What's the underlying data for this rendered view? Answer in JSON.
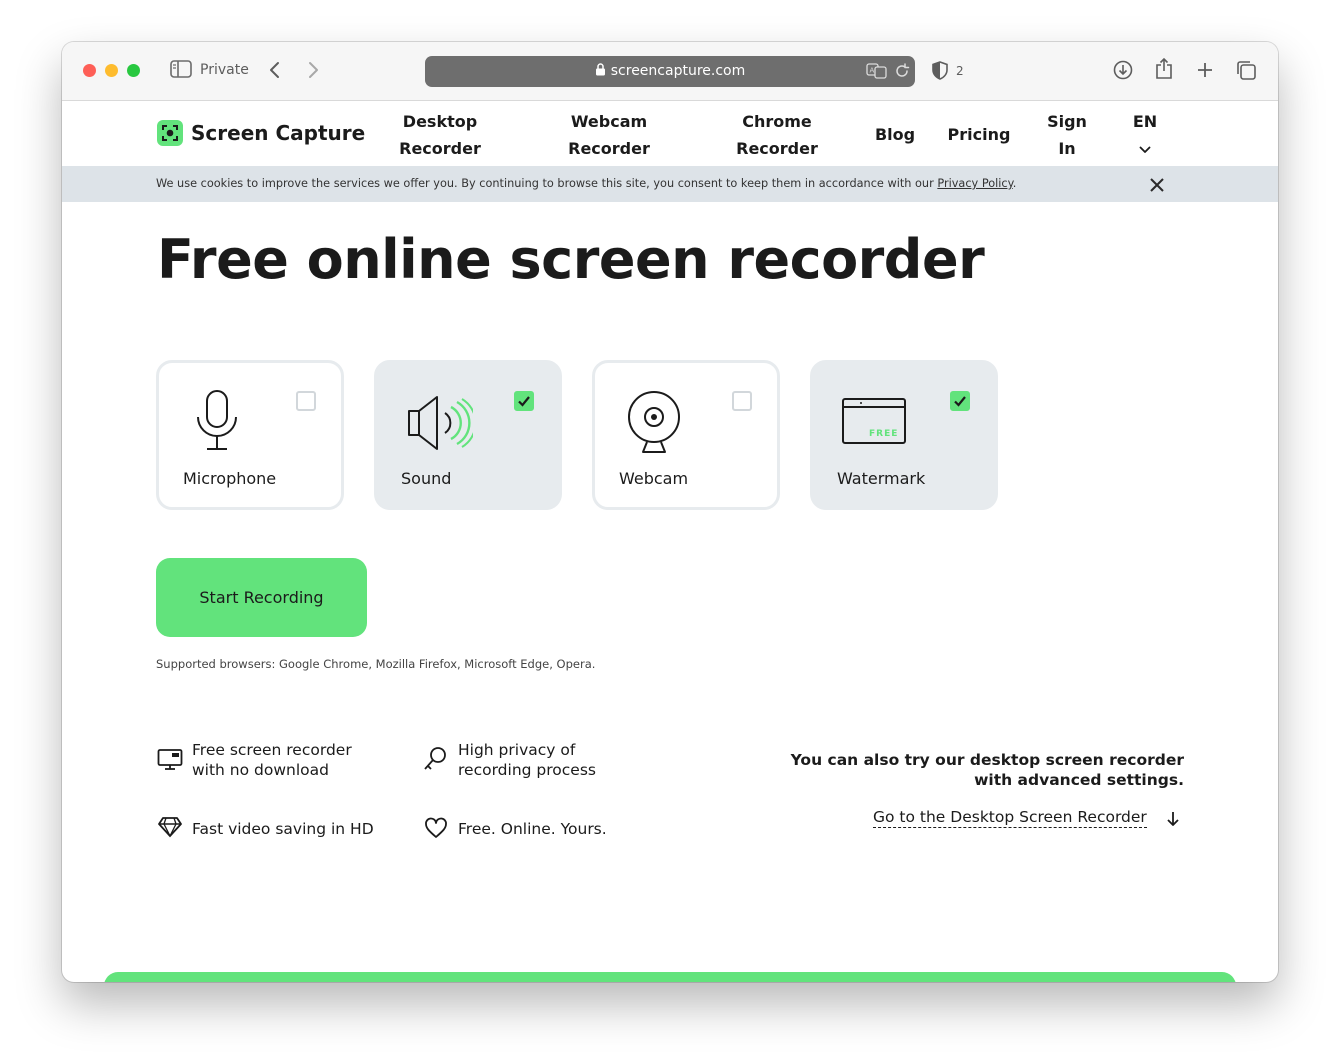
{
  "browser": {
    "private_label": "Private",
    "url": "screencapture.com",
    "shield_count": "2"
  },
  "site": {
    "brand": "Screen Capture",
    "nav": [
      {
        "line1": "Desktop",
        "line2": "Recorder"
      },
      {
        "line1": "Webcam",
        "line2": "Recorder"
      },
      {
        "line1": "Chrome",
        "line2": "Recorder"
      },
      {
        "line1": "Blog",
        "line2": ""
      },
      {
        "line1": "Pricing",
        "line2": ""
      },
      {
        "line1": "Sign",
        "line2": "In"
      },
      {
        "line1": "EN",
        "line2": ""
      }
    ]
  },
  "cookie": {
    "text": "We use cookies to improve the services we offer you. By continuing to browse this site, you consent to keep them in accordance with our ",
    "link": "Privacy Policy",
    "tail": "."
  },
  "hero": {
    "title": "Free online screen recorder",
    "options": [
      {
        "label": "Microphone",
        "checked": false,
        "icon": "microphone-icon"
      },
      {
        "label": "Sound",
        "checked": true,
        "icon": "speaker-icon"
      },
      {
        "label": "Webcam",
        "checked": false,
        "icon": "webcam-icon"
      },
      {
        "label": "Watermark",
        "checked": true,
        "icon": "watermark-icon",
        "badge": "FREE"
      }
    ],
    "start_button": "Start Recording",
    "supported": "Supported browsers: Google Chrome, Mozilla Firefox, Microsoft Edge, Opera."
  },
  "features": [
    {
      "line1": "Free screen recorder",
      "line2": "with no download",
      "icon": "monitor-icon"
    },
    {
      "line1": "High privacy of",
      "line2": "recording process",
      "icon": "key-icon"
    },
    {
      "line1": "Fast video saving in HD",
      "line2": "",
      "icon": "diamond-icon"
    },
    {
      "line1": "Free. Online. Yours.",
      "line2": "",
      "icon": "heart-icon"
    }
  ],
  "promo": {
    "line1": "You can also try our desktop screen recorder",
    "line2": "with advanced settings.",
    "link": "Go to the Desktop Screen Recorder"
  },
  "colors": {
    "accent": "#62e37c",
    "card_checked_bg": "#e7ebee",
    "cookie_bg": "#dde3e8",
    "address_bar": "#6e6e6e"
  }
}
